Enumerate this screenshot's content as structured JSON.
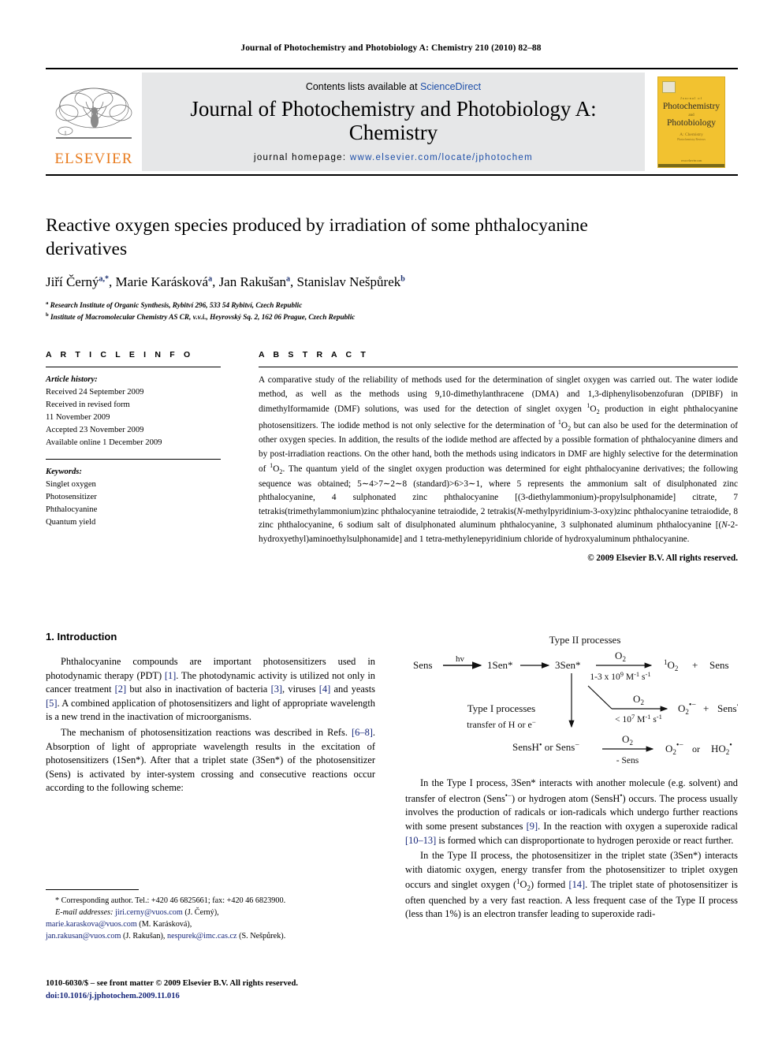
{
  "running_head": "Journal of Photochemistry and Photobiology A: Chemistry 210 (2010) 82–88",
  "masthead": {
    "publisher_name": "ELSEVIER",
    "contents_prefix": "Contents lists available at ",
    "contents_link": "ScienceDirect",
    "journal_title": "Journal of Photochemistry and Photobiology A: Chemistry",
    "homepage_label": "journal homepage: ",
    "homepage_url": "www.elsevier.com/locate/jphotochem",
    "cover": {
      "journal_word": "Journal of",
      "line1": "Photochemistry",
      "and": "and",
      "line2": "Photobiology",
      "subtitle": "A: Chemistry",
      "subtitle2": "Photochemistry Reviews",
      "footer": "www.elsevier.com"
    }
  },
  "article": {
    "title": "Reactive oxygen species produced by irradiation of some phthalocyanine derivatives",
    "authors_html": "Jiří Černý<sup>a,*</sup>, Marie Karásková<sup>a</sup>, Jan Rakušan<sup>a</sup>, Stanislav Nešpůrek<sup>b</sup>",
    "affiliation_a": "Research Institute of Organic Synthesis, Rybitví 296, 533 54 Rybitví, Czech Republic",
    "affiliation_b": "Institute of Macromolecular Chemistry AS CR, v.v.i., Heyrovský Sq. 2, 162 06 Prague, Czech Republic"
  },
  "article_info": {
    "heading": "A R T I C L E    I N F O",
    "history_label": "Article history:",
    "history": [
      "Received 24 September 2009",
      "Received in revised form",
      "11 November 2009",
      "Accepted 23 November 2009",
      "Available online 1 December 2009"
    ],
    "keywords_label": "Keywords:",
    "keywords": [
      "Singlet oxygen",
      "Photosensitizer",
      "Phthalocyanine",
      "Quantum yield"
    ]
  },
  "abstract": {
    "heading": "A B S T R A C T",
    "text_html": "A comparative study of the reliability of methods used for the determination of singlet oxygen was carried out. The water iodide method, as well as the methods using 9,10-dimethylanthracene (DMA) and 1,3-diphenylisobenzofuran (DPIBF) in dimethylformamide (DMF) solutions, was used for the detection of singlet oxygen <sup>1</sup>O<sub>2</sub> production in eight phthalocyanine photosensitizers. The iodide method is not only selective for the determination of <sup>1</sup>O<sub>2</sub> but can also be used for the determination of other oxygen species. In addition, the results of the iodide method are affected by a possible formation of phthalocyanine dimers and by post-irradiation reactions. On the other hand, both the methods using indicators in DMF are highly selective for the determination of <sup>1</sup>O<sub>2</sub>. The quantum yield of the singlet oxygen production was determined for eight phthalocyanine derivatives; the following sequence was obtained; 5∼4&gt;7∼2∼8 (standard)&gt;6&gt;3∼1, where 5 represents the ammonium salt of disulphonated zinc phthalocyanine, 4 sulphonated zinc phthalocyanine [(3-diethylammonium)-propylsulphonamide] citrate, 7 tetrakis(trimethylammonium)zinc phthalocyanine tetraiodide, 2 tetrakis(<i>N</i>-methylpyridinium-3-oxy)zinc phthalocyanine tetraiodide, 8 zinc phthalocyanine, 6 sodium salt of disulphonated aluminum phthalocyanine, 3 sulphonated aluminum phthalocyanine [(<i>N</i>-2-hydroxyethyl)aminoethylsulphonamide] and 1 tetra-methylenepyridinium chloride of hydroxyaluminum phthalocyanine.",
    "copyright": "© 2009 Elsevier B.V. All rights reserved."
  },
  "introduction": {
    "heading": "1.  Introduction",
    "p1_html": "Phthalocyanine compounds are important photosensitizers used in photodynamic therapy (PDT) <span class=\"cite\">[1]</span>. The photodynamic activity is utilized not only in cancer treatment <span class=\"cite\">[2]</span> but also in inactivation of bacteria <span class=\"cite\">[3]</span>, viruses <span class=\"cite\">[4]</span> and yeasts <span class=\"cite\">[5]</span>. A combined application of photosensitizers and light of appropriate wavelength is a new trend in the inactivation of microorganisms.",
    "p2_html": "The mechanism of photosensitization reactions was described in Refs. <span class=\"cite\">[6–8]</span>. Absorption of light of appropriate wavelength results in the excitation of photosensitizers (1Sen*). After that a triplet state (3Sen*) of the photosensitizer (Sens) is activated by inter-system crossing and consecutive reactions occur according to the following scheme:",
    "p3_html": "In the Type I process, 3Sen* interacts with another molecule (e.g. solvent) and transfer of electron (Sens<sup>•−</sup>) or hydrogen atom (SensH<sup>•</sup>) occurs. The process usually involves the production of radicals or ion-radicals which undergo further reactions with some present substances <span class=\"cite\">[9]</span>. In the reaction with oxygen a superoxide radical <span class=\"cite\">[10–13]</span> is formed which can disproportionate to hydrogen peroxide or react further.",
    "p4_html": "In the Type II process, the photosensitizer in the triplet state (3Sen*) interacts with diatomic oxygen, energy transfer from the photosensitizer to triplet oxygen occurs and singlet oxygen (<sup>1</sup>O<sub>2</sub>) formed <span class=\"cite\">[14]</span>. The triplet state of photosensitizer is often quenched by a very fast reaction. A less frequent case of the Type II process (less than 1%) is an electron transfer leading to superoxide radi-"
  },
  "scheme": {
    "type_ii_label": "Type II processes",
    "sens": "Sens",
    "hv": "hv",
    "sen1": "1Sen*",
    "sen3": "3Sen*",
    "o2_a": "O",
    "o2_a_sub": "2",
    "rate_ii": "1-3 x 10⁹ M⁻¹ s⁻¹",
    "prod_ii_1": "O",
    "prod_ii_1_sup": "1",
    "prod_ii_1_sub": "2",
    "plus": "+",
    "prod_ii_2": "Sens",
    "rate_i": "< 10⁷ M⁻¹ s⁻¹",
    "prod_sup_o2": "O",
    "prod_sup_sens": "Sens",
    "type_i_label": "Type I processes",
    "type_i_sub": "transfer of H or e⁻",
    "sensh_line": "SensH• or Sens−",
    "minus_sens": "- Sens",
    "or_label": "or",
    "ho2": "HO"
  },
  "footnotes": {
    "corresponding": "* Corresponding author. Tel.: +420 46 6825661; fax: +420 46 6823900.",
    "email_label": "E-mail addresses:",
    "emails": [
      {
        "address": "jiri.cerny@vuos.com",
        "person": "(J. Černý),"
      },
      {
        "address": "marie.karaskova@vuos.com",
        "person": "(M. Karásková),"
      },
      {
        "address": "jan.rakusan@vuos.com",
        "person": "(J. Rakušan),"
      },
      {
        "address": "nespurek@imc.cas.cz",
        "person": "(S. Nešpůrek)."
      }
    ]
  },
  "footer": {
    "issn_line": "1010-6030/$ – see front matter © 2009 Elsevier B.V. All rights reserved.",
    "doi": "doi:10.1016/j.jphotochem.2009.11.016"
  }
}
